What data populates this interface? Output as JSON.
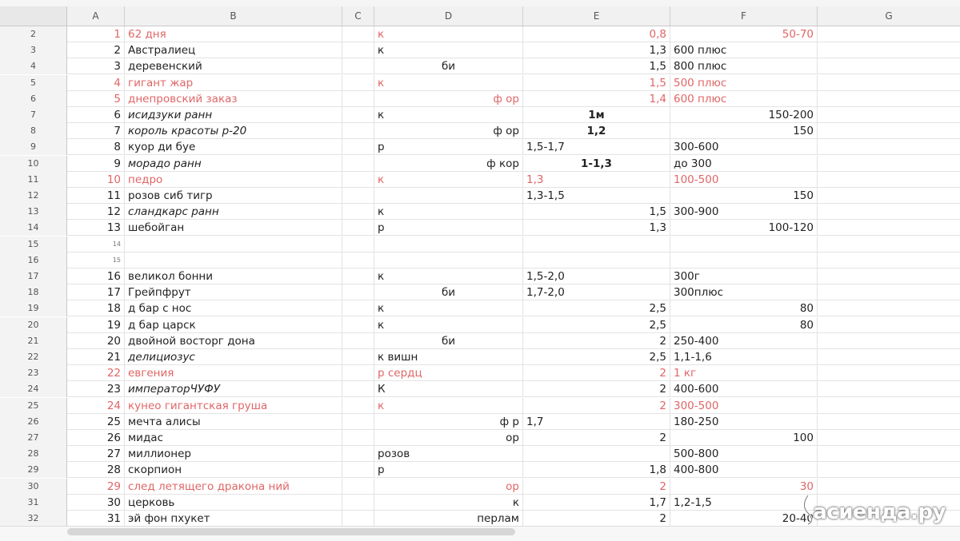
{
  "columns": [
    "A",
    "B",
    "C",
    "D",
    "E",
    "F",
    "G"
  ],
  "rows": [
    {
      "num": "2",
      "A": "1",
      "B": "62 дня",
      "D": "к",
      "E": "0,8",
      "F": "50-70",
      "color": "red",
      "D_align": "l",
      "E_align": "r",
      "F_align": "r"
    },
    {
      "num": "3",
      "A": "2",
      "B": "Австралиец",
      "D": "к",
      "E": "1,3",
      "F": "600 плюс",
      "D_align": "l",
      "E_align": "r",
      "F_align": "l"
    },
    {
      "num": "4",
      "A": "3",
      "B": "деревенский",
      "D": "би",
      "E": "1,5",
      "F": "800 плюс",
      "D_align": "c",
      "E_align": "r",
      "F_align": "l"
    },
    {
      "num": "5",
      "A": "4",
      "B": "гигант жар",
      "D": "к",
      "E": "1,5",
      "F": "500 плюс",
      "color": "red",
      "D_align": "l",
      "E_align": "r",
      "F_align": "l"
    },
    {
      "num": "6",
      "A": "5",
      "B": "днепровский заказ",
      "D": "ф ор",
      "E": "1,4",
      "F": "600 плюс",
      "color": "red",
      "D_align": "r",
      "E_align": "r",
      "F_align": "l"
    },
    {
      "num": "7",
      "A": "6",
      "B": "исидзуки ранн",
      "D": "к",
      "E": "1м",
      "F": "150-200",
      "italic": true,
      "D_align": "l",
      "E_align": "c",
      "E_bold": true,
      "F_align": "r"
    },
    {
      "num": "8",
      "A": "7",
      "B": "король красоты р-20",
      "D": "ф ор",
      "E": "1,2",
      "F": "150",
      "italic": true,
      "D_align": "r",
      "E_align": "c",
      "E_bold": true,
      "F_align": "r"
    },
    {
      "num": "9",
      "A": "8",
      "B": "куор ди буе",
      "D": "р",
      "E": "1,5-1,7",
      "F": "300-600",
      "D_align": "l",
      "E_align": "l",
      "F_align": "l"
    },
    {
      "num": "10",
      "A": "9",
      "B": "морадо ранн",
      "D": "ф кор",
      "E": "1-1,3",
      "F": "до 300",
      "italic": true,
      "D_align": "r",
      "E_align": "c",
      "E_bold": true,
      "F_align": "l"
    },
    {
      "num": "11",
      "A": "10",
      "B": "педро",
      "D": "к",
      "E": "1,3",
      "F": "100-500",
      "color": "red",
      "D_align": "l",
      "E_align": "l",
      "F_align": "l"
    },
    {
      "num": "12",
      "A": "11",
      "B": "розов сиб тигр",
      "D": "",
      "E": "1,3-1,5",
      "F": "150",
      "D_align": "l",
      "E_align": "l",
      "F_align": "r"
    },
    {
      "num": "13",
      "A": "12",
      "B": "сландкарс ранн",
      "D": "к",
      "E": "1,5",
      "F": "300-900",
      "italic": true,
      "D_align": "l",
      "E_align": "r",
      "F_align": "l"
    },
    {
      "num": "14",
      "A": "13",
      "B": "шебойган",
      "D": "р",
      "E": "1,3",
      "F": "100-120",
      "D_align": "l",
      "E_align": "r",
      "F_align": "r"
    },
    {
      "num": "15",
      "A": "14",
      "A_small": true,
      "B": "",
      "D": "",
      "E": "",
      "F": ""
    },
    {
      "num": "16",
      "A": "15",
      "A_small": true,
      "B": "",
      "D": "",
      "E": "",
      "F": ""
    },
    {
      "num": "17",
      "A": "16",
      "B": "великол бонни",
      "D": "к",
      "E": "1,5-2,0",
      "F": "300г",
      "D_align": "l",
      "E_align": "l",
      "F_align": "l"
    },
    {
      "num": "18",
      "A": "17",
      "B": "Грейпфрут",
      "D": "би",
      "E": "1,7-2,0",
      "F": "300плюс",
      "D_align": "c",
      "E_align": "l",
      "F_align": "l"
    },
    {
      "num": "19",
      "A": "18",
      "B": "д бар с нос",
      "D": "к",
      "E": "2,5",
      "F": "80",
      "D_align": "l",
      "E_align": "r",
      "F_align": "r"
    },
    {
      "num": "20",
      "A": "19",
      "B": "д бар царск",
      "D": "к",
      "E": "2,5",
      "F": "80",
      "D_align": "l",
      "E_align": "r",
      "F_align": "r"
    },
    {
      "num": "21",
      "A": "20",
      "B": "двойной восторг дона",
      "D": "би",
      "E": "2",
      "F": "250-400",
      "D_align": "c",
      "E_align": "r",
      "F_align": "l"
    },
    {
      "num": "22",
      "A": "21",
      "B": "делициозус",
      "D": "к вишн",
      "E": "2,5",
      "F": "1,1-1,6",
      "italic": true,
      "D_align": "l",
      "E_align": "r",
      "F_align": "l"
    },
    {
      "num": "23",
      "A": "22",
      "B": "евгения",
      "D": "р сердц",
      "E": "2",
      "F": "1 кг",
      "color": "red",
      "D_align": "l",
      "E_align": "r",
      "F_align": "l"
    },
    {
      "num": "24",
      "A": "23",
      "B": "императорЧУФУ",
      "D": "К",
      "E": "2",
      "F": "400-600",
      "italic": true,
      "D_align": "l",
      "E_align": "r",
      "F_align": "l"
    },
    {
      "num": "25",
      "A": "24",
      "B": "кунео гигантская груша",
      "D": "к",
      "E": "2",
      "F": "300-500",
      "color": "red",
      "D_align": "l",
      "E_align": "r",
      "F_align": "l"
    },
    {
      "num": "26",
      "A": "25",
      "B": "мечта алисы",
      "D": "ф р",
      "E": "1,7",
      "F": "180-250",
      "D_align": "r",
      "E_align": "l",
      "F_align": "l"
    },
    {
      "num": "27",
      "A": "26",
      "B": "мидас",
      "D": "ор",
      "E": "2",
      "F": "100",
      "D_align": "r",
      "E_align": "r",
      "F_align": "r"
    },
    {
      "num": "28",
      "A": "27",
      "B": "миллионер",
      "D": "розов",
      "E": "",
      "F": "500-800",
      "D_align": "l",
      "E_align": "r",
      "F_align": "l"
    },
    {
      "num": "29",
      "A": "28",
      "B": "скорпион",
      "D": "р",
      "E": "1,8",
      "F": "400-800",
      "D_align": "l",
      "E_align": "r",
      "F_align": "l"
    },
    {
      "num": "30",
      "A": "29",
      "B": "след летящего дракона ний",
      "D": "ор",
      "E": "2",
      "F": "30",
      "color": "red",
      "D_align": "r",
      "E_align": "r",
      "F_align": "r"
    },
    {
      "num": "31",
      "A": "30",
      "B": "церковь",
      "D": "к",
      "E": "1,7",
      "F": "1,2-1,5",
      "D_align": "r",
      "E_align": "r",
      "F_align": "l"
    },
    {
      "num": "32",
      "A": "31",
      "B": "эй фон пхукет",
      "D": "перлам",
      "E": "2",
      "F": "20-40",
      "D_align": "r",
      "E_align": "r",
      "F_align": "r"
    }
  ],
  "watermark": "асиенда.ру",
  "colors": {
    "red_text": "#e06666",
    "header_bg": "#f1f1f1",
    "grid": "#e3e3e3"
  }
}
